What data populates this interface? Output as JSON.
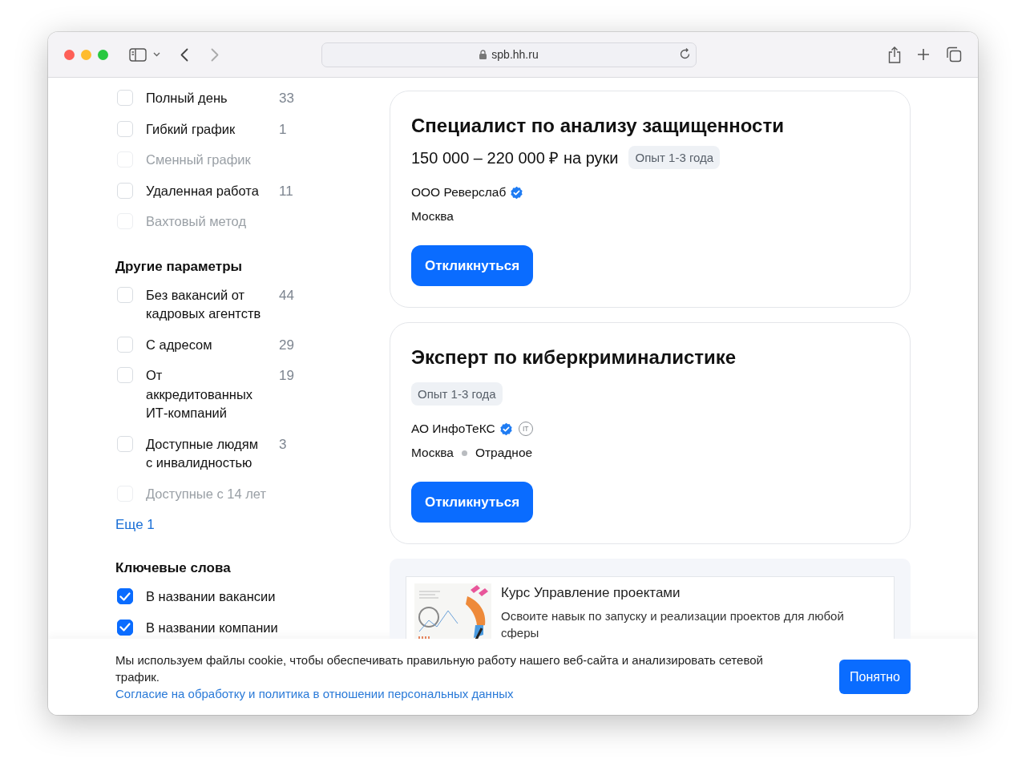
{
  "browser": {
    "url": "spb.hh.ru"
  },
  "filters": {
    "groups": [
      {
        "items": [
          {
            "label": "Полный день",
            "count": "33",
            "checked": false,
            "disabled": false
          },
          {
            "label": "Гибкий график",
            "count": "1",
            "checked": false,
            "disabled": false
          },
          {
            "label": "Сменный график",
            "checked": false,
            "disabled": true
          },
          {
            "label": "Удаленная работа",
            "count": "11",
            "checked": false,
            "disabled": false
          },
          {
            "label": "Вахтовый метод",
            "checked": false,
            "disabled": true
          }
        ]
      },
      {
        "title": "Другие параметры",
        "items": [
          {
            "label": "Без вакансий от кадровых агентств",
            "count": "44",
            "checked": false,
            "disabled": false
          },
          {
            "label": "С адресом",
            "count": "29",
            "checked": false,
            "disabled": false
          },
          {
            "label": "От аккредитованных ИТ-компаний",
            "count": "19",
            "checked": false,
            "disabled": false
          },
          {
            "label": "Доступные людям с инвалидностью",
            "count": "3",
            "checked": false,
            "disabled": false
          },
          {
            "label": "Доступные с 14 лет",
            "checked": false,
            "disabled": true
          }
        ],
        "more_link": "Еще 1"
      },
      {
        "title": "Ключевые слова",
        "items": [
          {
            "label": "В названии вакансии",
            "checked": true,
            "disabled": false
          },
          {
            "label": "В названии компании",
            "checked": true,
            "disabled": false
          }
        ]
      }
    ]
  },
  "vacancies": [
    {
      "title": "Специалист по анализу защищенности",
      "salary": "150 000 – 220 000 ₽ на руки",
      "experience": "Опыт 1-3 года",
      "company": "ООО Реверслаб",
      "verified": true,
      "city": "Москва",
      "button": "Откликнуться"
    },
    {
      "title": "Эксперт по киберкриминалистике",
      "experience": "Опыт 1-3 года",
      "company": "АО ИнфоТеКС",
      "verified": true,
      "company_badge": "IT",
      "city": "Москва",
      "metro": "Отрадное",
      "button": "Откликнуться"
    }
  ],
  "ad": {
    "title": "Курс Управление проектами",
    "description": "Освоите навык по запуску и реализации проектов для любой сферы"
  },
  "cookie_banner": {
    "text": "Мы используем файлы cookie, чтобы обеспечивать правильную работу нашего веб-сайта и анализировать сетевой трафик.",
    "link": "Согласие на обработку и политика в отношении персональных данных",
    "button": "Понятно"
  }
}
